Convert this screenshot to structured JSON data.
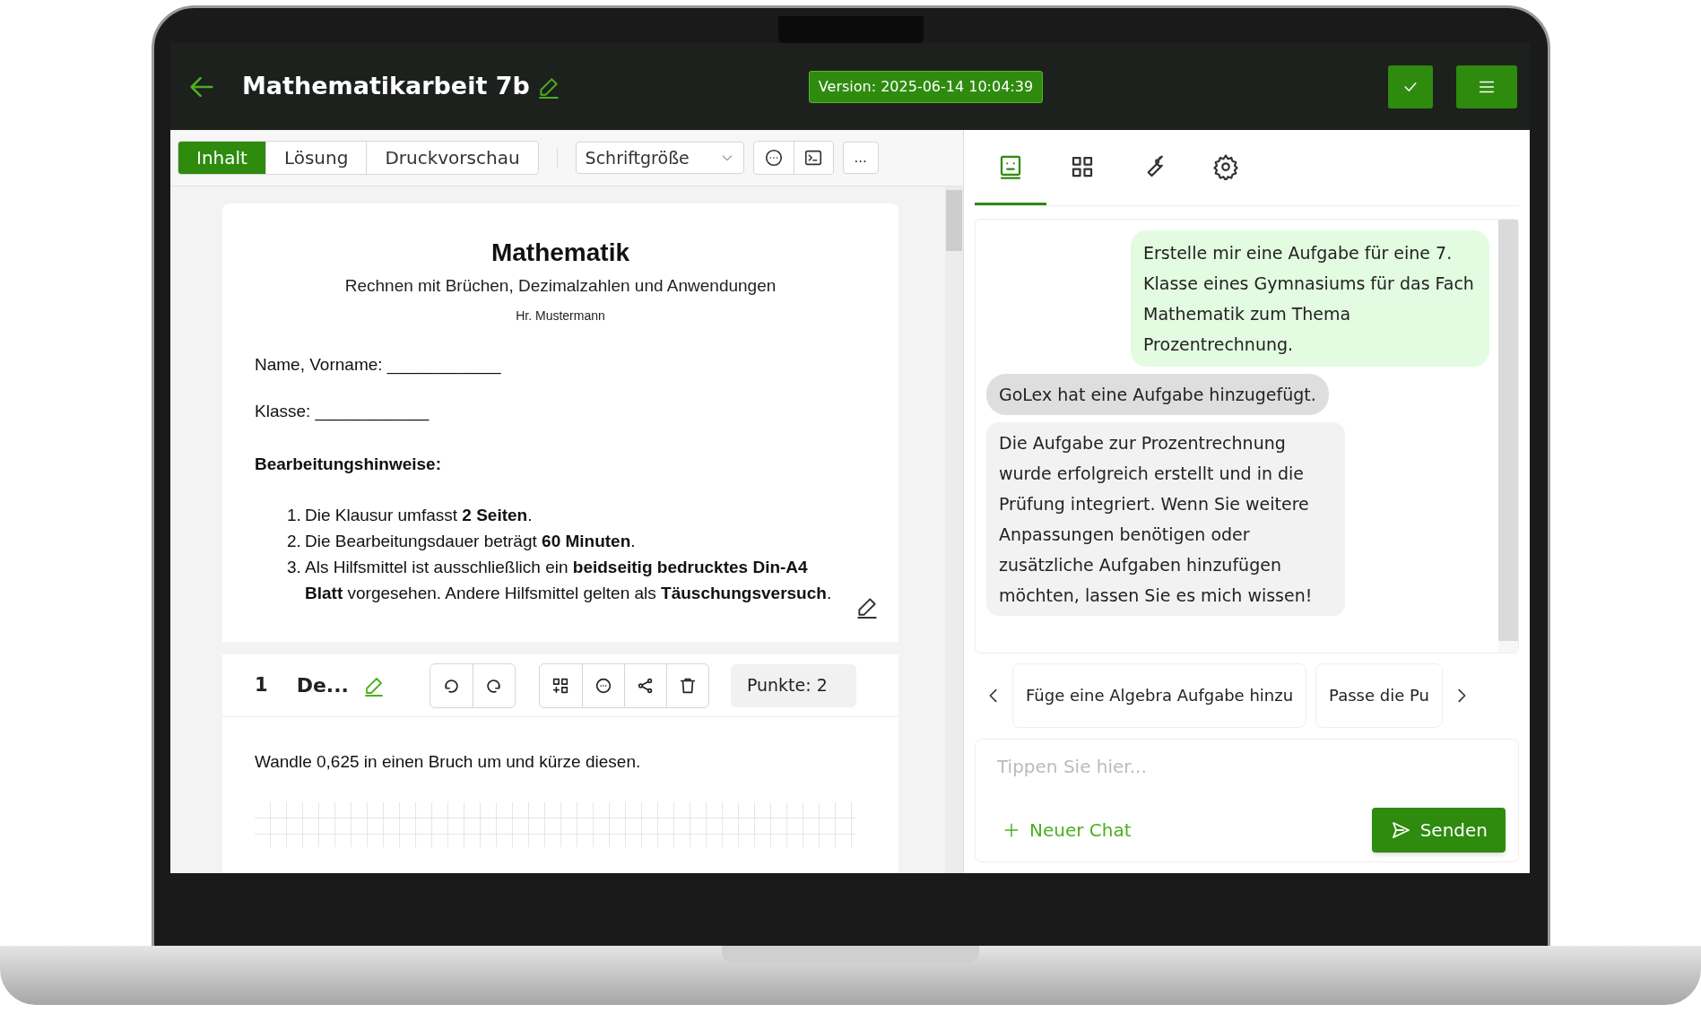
{
  "app_bar": {
    "title": "Mathematikarbeit 7b",
    "version": "Version: 2025-06-14 10:04:39"
  },
  "view_tabs": [
    {
      "label": "Inhalt",
      "selected": true
    },
    {
      "label": "Lösung",
      "selected": false
    },
    {
      "label": "Druckvorschau",
      "selected": false
    }
  ],
  "font_size_select": {
    "placeholder": "Schriftgröße"
  },
  "more_button": "...",
  "document": {
    "title": "Mathematik",
    "subtitle": "Rechnen mit Brüchen, Dezimalzahlen und Anwendungen",
    "author": "Hr. Mustermann",
    "fields": [
      "Name, Vorname: ____________",
      "Klasse: ____________"
    ],
    "instructions_heading": "Bearbeitungshinweise:",
    "instructions": [
      {
        "number": "1.",
        "text": "Die Klausur umfasst **2 Seiten**."
      },
      {
        "number": "2.",
        "text": "Die Bearbeitungsdauer beträgt **60 Minuten**."
      },
      {
        "number": "3.",
        "text": "Als Hilfsmittel ist ausschließlich ein **beidseitig bedrucktes Din-A4 Blatt** vorgesehen. Andere Hilfsmittel gelten als **Täuschungsversuch**."
      }
    ]
  },
  "task": {
    "number": "1",
    "title": "De...",
    "points": "Punkte: 2",
    "prompt": "Wandle 0,625 in einen Bruch um und kürze diesen."
  },
  "panel_tabs": [
    {
      "kind": "assistant",
      "selected": true
    },
    {
      "kind": "grid",
      "selected": false
    },
    {
      "kind": "tools",
      "selected": false
    },
    {
      "kind": "settings",
      "selected": false
    }
  ],
  "chat": {
    "messages": [
      {
        "kind": "user",
        "text": "Erstelle mir eine Aufgabe für eine 7. Klasse eines Gymnasiums für das Fach Mathematik zum Thema Prozentrechnung."
      },
      {
        "kind": "event",
        "text": "GoLex hat eine Aufgabe hinzugefügt."
      },
      {
        "kind": "assistant",
        "text": "Die Aufgabe zur Prozentrechnung wurde erfolgreich erstellt und in die Prüfung integriert. Wenn Sie weitere Anpassungen benötigen oder zusätzliche Aufgaben hinzufügen möchten, lassen Sie es mich wissen!"
      }
    ],
    "suggestions": [
      "Füge eine Algebra Aufgabe hinzu",
      "Passe die Pu"
    ],
    "input": {
      "placeholder": "Tippen Sie hier..."
    },
    "new_chat": "Neuer Chat",
    "send": "Senden"
  }
}
